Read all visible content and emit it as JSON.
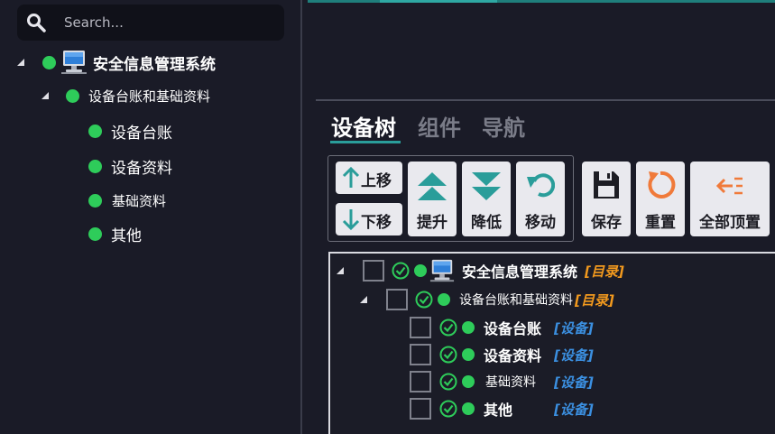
{
  "search": {
    "placeholder": "Search..."
  },
  "left_tree": [
    {
      "label": "安全信息管理系统",
      "icon": "computer-icon"
    },
    {
      "label": "设备台账和基础资料"
    },
    {
      "label": "设备台账"
    },
    {
      "label": "设备资料"
    },
    {
      "label": "基础资料"
    },
    {
      "label": "其他"
    }
  ],
  "tabs": [
    {
      "label": "设备树",
      "active": true
    },
    {
      "label": "组件",
      "active": false
    },
    {
      "label": "导航",
      "active": false
    }
  ],
  "toolbar": {
    "move_up": "上移",
    "move_down": "下移",
    "promote": "提升",
    "demote": "降低",
    "move": "移动",
    "save": "保存",
    "reset": "重置",
    "top_all": "全部顶置"
  },
  "right_tree": [
    {
      "label": "安全信息管理系统",
      "tag": "[目录]",
      "icon": "computer-icon"
    },
    {
      "label": "设备台账和基础资料",
      "tag": "[目录]"
    },
    {
      "label": "设备台账",
      "tag": "[设备]"
    },
    {
      "label": "设备资料",
      "tag": "[设备]"
    },
    {
      "label": "基础资料",
      "tag": "[设备]"
    },
    {
      "label": "其他",
      "tag": "[设备]"
    }
  ],
  "colors": {
    "background": "#1a1b27",
    "status_green": "#2ecc5a",
    "accent_teal": "#2a9d9a",
    "directory_tag": "#f39a1e",
    "device_tag": "#3b8fe0",
    "reset_orange": "#f07a3a"
  }
}
